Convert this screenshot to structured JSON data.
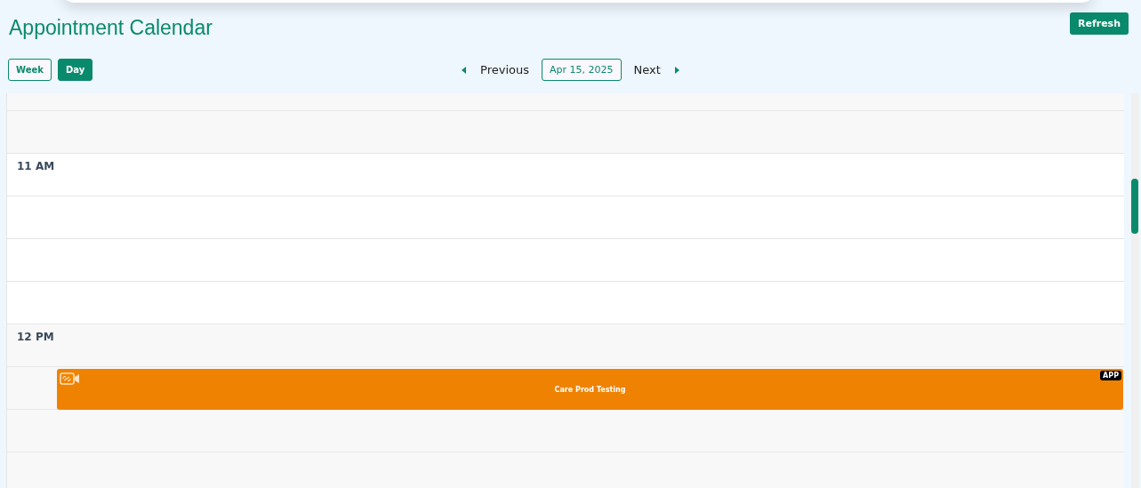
{
  "title": "Appointment Calendar",
  "refresh_button": "Refresh",
  "views": [
    {
      "label": "Week",
      "selected": false
    },
    {
      "label": "Day",
      "selected": true
    }
  ],
  "nav": {
    "previous": "Previous",
    "date": "Apr 15, 2025",
    "next": "Next"
  },
  "hours": [
    {
      "label": "11 AM"
    },
    {
      "label": "12 PM",
      "event": {
        "title": "Care Prod Testing",
        "badge": "APP",
        "color": "#ef8200"
      }
    }
  ]
}
